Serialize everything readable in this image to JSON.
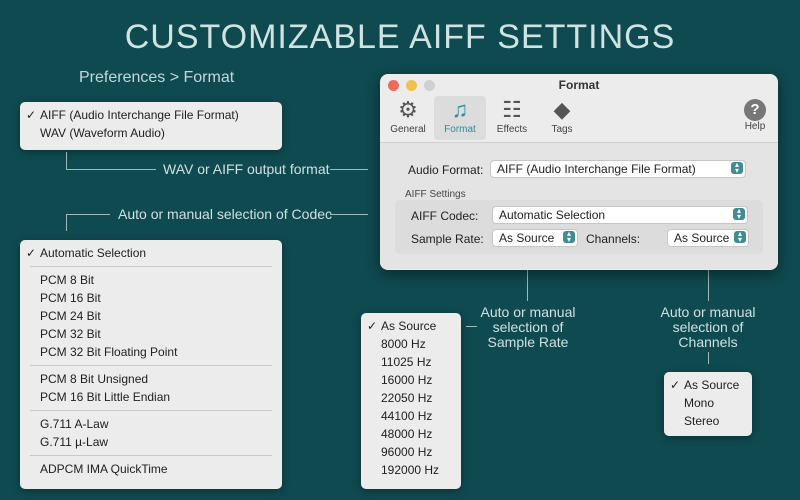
{
  "headline": "CUSTOMIZABLE AIFF SETTINGS",
  "breadcrumb": "Preferences > Format",
  "captions": {
    "format": "WAV or AIFF output format",
    "codec": "Auto or manual selection of Codec",
    "sample_rate": "Auto or manual\nselection of\nSample Rate",
    "channels": "Auto or manual\nselection of\nChannels"
  },
  "format_menu": {
    "items": [
      {
        "label": "AIFF (Audio Interchange File Format)",
        "checked": true
      },
      {
        "label": "WAV (Waveform Audio)",
        "checked": false
      }
    ]
  },
  "codec_menu": {
    "groups": [
      [
        {
          "label": "Automatic Selection",
          "checked": true
        }
      ],
      [
        {
          "label": "PCM 8 Bit"
        },
        {
          "label": "PCM 16 Bit"
        },
        {
          "label": "PCM 24 Bit"
        },
        {
          "label": "PCM 32 Bit"
        },
        {
          "label": "PCM 32 Bit Floating Point"
        }
      ],
      [
        {
          "label": "PCM 8 Bit Unsigned"
        },
        {
          "label": "PCM 16 Bit Little Endian"
        }
      ],
      [
        {
          "label": "G.711 A-Law"
        },
        {
          "label": "G.711 µ-Law"
        }
      ],
      [
        {
          "label": "ADPCM IMA QuickTime"
        }
      ]
    ]
  },
  "sample_rate_menu": {
    "items": [
      {
        "label": "As Source",
        "checked": true
      },
      {
        "label": "8000 Hz"
      },
      {
        "label": "11025 Hz"
      },
      {
        "label": "16000 Hz"
      },
      {
        "label": "22050 Hz"
      },
      {
        "label": "44100 Hz"
      },
      {
        "label": "48000 Hz"
      },
      {
        "label": "96000 Hz"
      },
      {
        "label": "192000 Hz"
      }
    ]
  },
  "channels_menu": {
    "items": [
      {
        "label": "As Source",
        "checked": true
      },
      {
        "label": "Mono"
      },
      {
        "label": "Stereo"
      }
    ]
  },
  "window": {
    "title": "Format",
    "toolbar": [
      {
        "label": "General",
        "icon": "gear-icon",
        "active": false
      },
      {
        "label": "Format",
        "icon": "music-note-icon",
        "active": true
      },
      {
        "label": "Effects",
        "icon": "sliders-icon",
        "active": false
      },
      {
        "label": "Tags",
        "icon": "tag-icon",
        "active": false
      },
      {
        "label": "Help",
        "icon": "help-icon",
        "active": false
      }
    ],
    "audio_format_label": "Audio Format:",
    "audio_format_value": "AIFF (Audio Interchange File Format)",
    "section_title": "AIFF Settings",
    "codec_label": "AIFF Codec:",
    "codec_value": "Automatic Selection",
    "sample_rate_label": "Sample Rate:",
    "sample_rate_value": "As Source",
    "channels_label": "Channels:",
    "channels_value": "As Source"
  },
  "colors": {
    "background": "#0f4a50",
    "accent": "#3f8c95",
    "close": "#ec6a5e",
    "minimize": "#f4bf4f",
    "zoom": "#d0d0d0"
  }
}
